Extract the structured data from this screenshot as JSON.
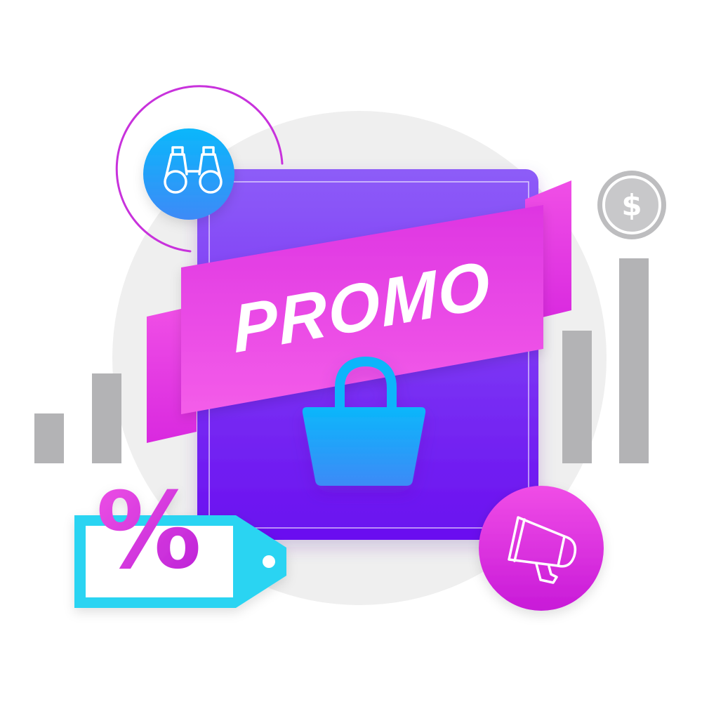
{
  "banner": {
    "text": "PROMO"
  },
  "discount_tag": {
    "symbol": "%"
  },
  "coin": {
    "symbol": "$"
  },
  "icons": {
    "binoculars": "binoculars-icon",
    "shopping_bag": "shopping-bag-icon",
    "megaphone": "megaphone-icon",
    "coin": "dollar-coin-icon",
    "price_tag": "price-tag-icon"
  },
  "bar_charts": {
    "left": [
      1,
      2
    ],
    "right": [
      2,
      4
    ]
  },
  "colors": {
    "background_circle": "#efefef",
    "card_top": "#8d5cf8",
    "card_bottom": "#6a0ff0",
    "banner_light": "#f25be3",
    "banner_dark": "#dd2be2",
    "bag": "#18a8f8",
    "binoculars_circle": "#1ba6f8",
    "megaphone_circle": "#e22ee0",
    "percent": "#d631e0",
    "tag_border": "#29d4f2",
    "bars": "#b3b3b5",
    "coin": "#bdbdbf"
  }
}
